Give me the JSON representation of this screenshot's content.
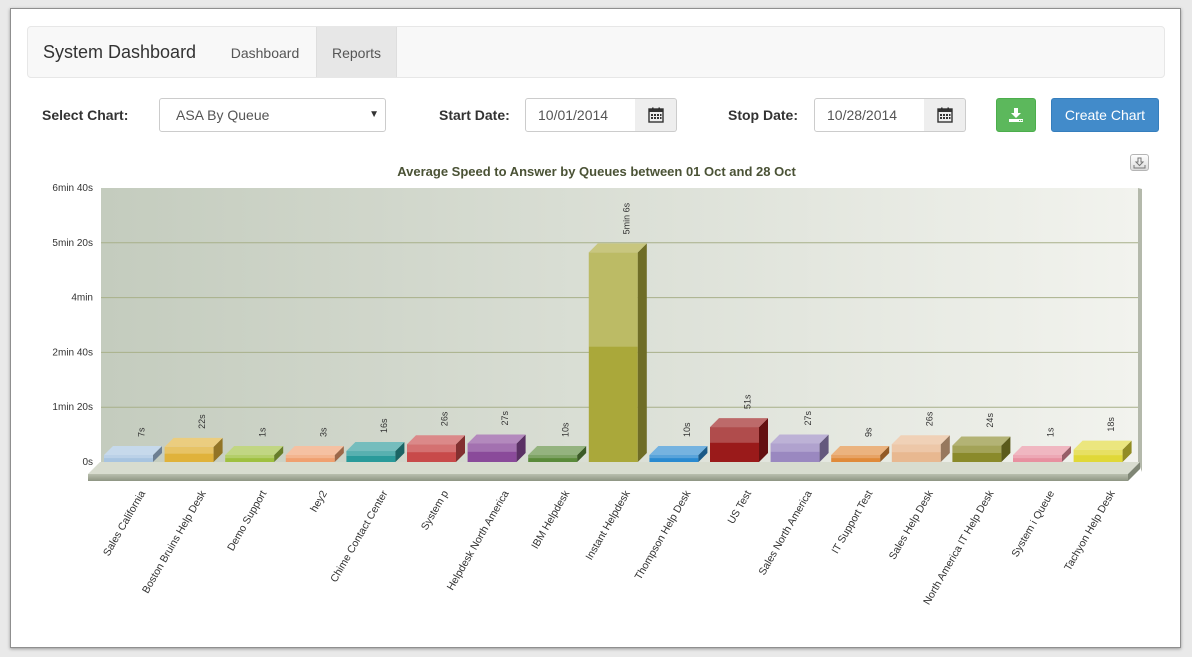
{
  "navbar": {
    "brand": "System Dashboard",
    "tabs": [
      {
        "label": "Dashboard",
        "active": false
      },
      {
        "label": "Reports",
        "active": true
      }
    ]
  },
  "controls": {
    "select_chart_label": "Select Chart:",
    "select_chart_value": "ASA By Queue",
    "start_date_label": "Start Date:",
    "start_date_value": "10/01/2014",
    "stop_date_label": "Stop Date:",
    "stop_date_value": "10/28/2014",
    "create_chart_label": "Create Chart",
    "download_icon": "download-icon",
    "calendar_icon": "calendar-icon"
  },
  "colors": {
    "download_button": "#5cb85c",
    "create_button": "#428bca",
    "plot_background": "#c9d0c2"
  },
  "chart_data": {
    "type": "bar",
    "title": "Average Speed to Answer by Queues between 01 Oct and 28 Oct",
    "y_unit": "seconds",
    "ylim": [
      0,
      400
    ],
    "y_ticks": [
      0,
      80,
      160,
      240,
      320,
      400
    ],
    "y_tick_labels": [
      "0s",
      "1min 20s",
      "2min 40s",
      "4min",
      "5min 20s",
      "6min 40s"
    ],
    "grid": true,
    "categories": [
      "Sales California",
      "Boston Bruins Help Desk",
      "Demo Support",
      "hey2",
      "Chime Contact Center",
      "System p",
      "Helpdesk North America",
      "IBM Helpdesk",
      "Instant Helpdesk",
      "Thompson Help Desk",
      "US Test",
      "Sales North America",
      "IT Support Test",
      "Sales Help Desk",
      "North America IT Help Desk",
      "System i Queue",
      "Tachyon Help Desk"
    ],
    "values": [
      7,
      22,
      1,
      3,
      16,
      26,
      27,
      10,
      306,
      10,
      51,
      27,
      9,
      26,
      24,
      1,
      18
    ],
    "data_labels": [
      "7s",
      "22s",
      "1s",
      "3s",
      "16s",
      "26s",
      "27s",
      "10s",
      "5min 6s",
      "10s",
      "51s",
      "27s",
      "9s",
      "26s",
      "24s",
      "1s",
      "18s"
    ],
    "colors": [
      "#a8c4e0",
      "#e0b23a",
      "#9fc040",
      "#f0a070",
      "#2a9a9a",
      "#c84a4a",
      "#8a4a9a",
      "#5a8a3a",
      "#aaa83a",
      "#2a8ad0",
      "#9a1a1a",
      "#9a88c0",
      "#e08a3a",
      "#e8b890",
      "#8a8a2a",
      "#e890a0",
      "#e0d838"
    ]
  }
}
